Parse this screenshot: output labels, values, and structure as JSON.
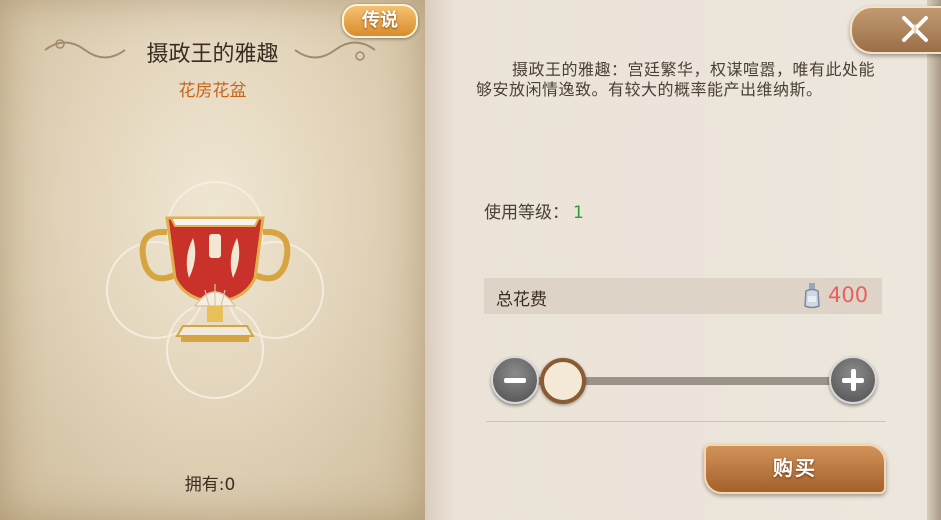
{
  "item": {
    "rarity": "传说",
    "name": "摄政王的雅趣",
    "category": "花房花盆",
    "owned": "拥有:0",
    "description": "摄政王的雅趣：宫廷繁华，权谋喧嚣，唯有此处能够安放闲情逸致。有较大的概率能产出维纳斯。"
  },
  "purchase": {
    "level_label": "使用等级：",
    "level_value": "1",
    "cost_label": "总花费",
    "cost_value": "400",
    "cost_currency_icon": "perfume-bottle-icon",
    "quantity_fraction": 0,
    "buy_label": "购买"
  },
  "icons": {
    "close": "close-x-icon",
    "minus": "minus-icon",
    "plus": "plus-icon"
  },
  "colors": {
    "rarity_gold": "#e0a040",
    "subtitle_orange": "#c8641a",
    "level_green": "#2f9a3a",
    "cost_red": "#e86060",
    "button_brown": "#b8733c"
  }
}
